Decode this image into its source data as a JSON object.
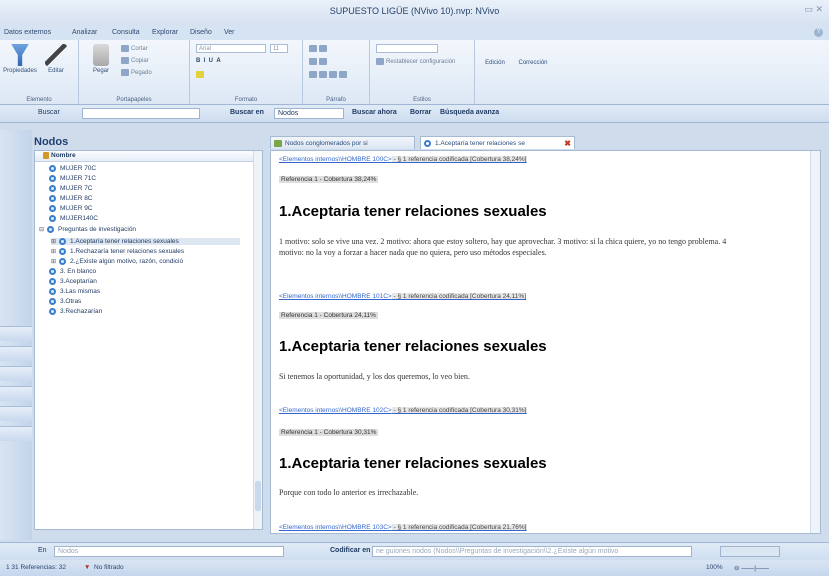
{
  "window": {
    "title": "SUPUESTO LIGÜE (NVivo 10).nvp: NVivo",
    "controls": "▭ ✕"
  },
  "menu": {
    "items": [
      "Datos externos",
      "Analizar",
      "Consulta",
      "Explorar",
      "Diseño",
      "Ver"
    ],
    "help": "?"
  },
  "ribbon": {
    "groups": [
      {
        "label": "Elemento",
        "buttons": [
          "Propiedades",
          "Editar"
        ]
      },
      {
        "label": "Portapapeles",
        "buttons": [
          "Pegar"
        ],
        "small": [
          "Cortar",
          "Copiar",
          "Pegado"
        ]
      },
      {
        "label": "Formato",
        "font_combo": "Arial",
        "size_combo": "11"
      },
      {
        "label": "Párrafo"
      },
      {
        "label": "Estilos",
        "small": [
          "Restablecer configuración"
        ]
      },
      {
        "label": "",
        "buttons": [
          "Edición",
          "Corrección"
        ]
      }
    ]
  },
  "find_bar": {
    "search_label": "Buscar",
    "search_value": "",
    "search_in_label": "Buscar en",
    "search_in_value": "Nodos",
    "find_now": "Buscar ahora",
    "clear": "Borrar",
    "advanced": "Búsqueda avanza"
  },
  "nav": {
    "header": "Nodos",
    "column_name": "Nombre",
    "nodes": [
      {
        "label": "MUJER 70C",
        "level": 1
      },
      {
        "label": "MUJER 71C",
        "level": 1
      },
      {
        "label": "MUJER 7C",
        "level": 1
      },
      {
        "label": "MUJER 8C",
        "level": 1
      },
      {
        "label": "MUJER 9C",
        "level": 1
      },
      {
        "label": "MUJER140C",
        "level": 1
      },
      {
        "label": "Preguntas de investigación",
        "level": 0,
        "expander": "⊟"
      },
      {
        "label": "1.Aceptaría tener relaciones sexuales",
        "level": 1,
        "expander": "⊞",
        "selected": true
      },
      {
        "label": "1.Rechazaría tener relaciones sexuales",
        "level": 1,
        "expander": "⊞"
      },
      {
        "label": "2.¿Existe algún motivo, razón, condició",
        "level": 1,
        "expander": "⊞"
      },
      {
        "label": "3. En blanco",
        "level": 1
      },
      {
        "label": "3.Aceptarían",
        "level": 1
      },
      {
        "label": "3.Las mismas",
        "level": 1
      },
      {
        "label": "3.Otras",
        "level": 1
      },
      {
        "label": "3.Rechazarían",
        "level": 1
      }
    ]
  },
  "tabs": [
    {
      "label": "Nodos conglomerados por si",
      "active": false
    },
    {
      "label": "1.Aceptaría tener relaciones se",
      "active": true,
      "close": "✖"
    }
  ],
  "detail": {
    "blocks": [
      {
        "link": "<Elementos internos\\\\HOMBRE 100C>",
        "meta": " - § 1 referencia codificada  [Cobertura 38,24%]",
        "ref": "Referencia 1 - Cobertura 38,24%",
        "heading": "1.Aceptaria tener relaciones sexuales",
        "text": "1 motivo: solo se vive una vez. 2 motivo: ahora que estoy soltero, hay que aprovechar. 3 motivo: si la chica quiere, yo no tengo problema. 4 motivo: no la voy a forzar a hacer nada que no quiera, pero uso métodos especiales."
      },
      {
        "link": "<Elementos internos\\\\HOMBRE 101C>",
        "meta": " - § 1 referencia codificada  [Cobertura 24,11%]",
        "ref": "Referencia 1 - Cobertura 24,11%",
        "heading": "1.Aceptaria tener relaciones sexuales",
        "text": "Si tenemos la oportunidad, y los dos queremos, lo veo bien."
      },
      {
        "link": "<Elementos internos\\\\HOMBRE 102C>",
        "meta": " - § 1 referencia codificada  [Cobertura 30,31%]",
        "ref": "Referencia 1 - Cobertura 30,31%",
        "heading": "1.Aceptaria tener relaciones sexuales",
        "text": "Porque con todo lo anterior es irrechazable."
      },
      {
        "link": "<Elementos internos\\\\HOMBRE 103C>",
        "meta": " - § 1 referencia codificada  [Cobertura 21,76%]"
      }
    ]
  },
  "bottom_bar": {
    "in_label": "En",
    "in_value": "Nodos",
    "code_at_label": "Codificar en",
    "code_at_value": "ne guiones nodos (Nodos\\\\Preguntas de investigación\\\\2.¿Existe algún motivo"
  },
  "status": {
    "items": "1 31 Referencias: 32",
    "filter": "No filtrado",
    "zoom": "100%"
  },
  "colors": {
    "accent": "#3a7ecb",
    "link": "#3366cc",
    "ribbon": "#dde8f5"
  }
}
